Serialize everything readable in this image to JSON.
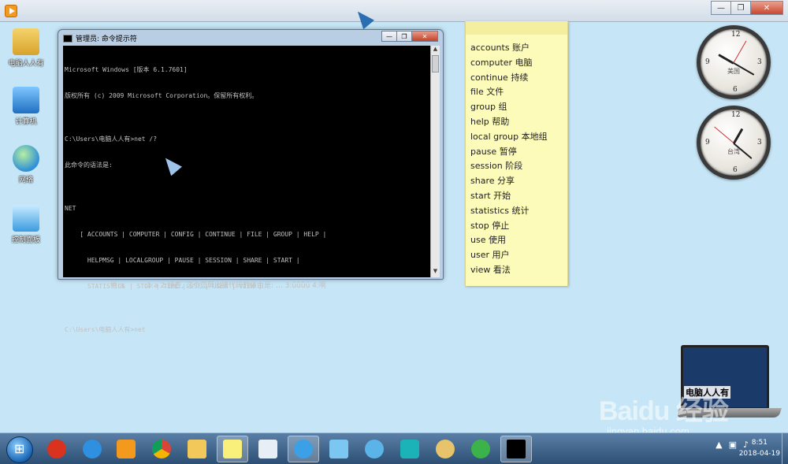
{
  "desktop": {
    "icons": [
      {
        "label": "电脑人人有"
      },
      {
        "label": "计算机"
      },
      {
        "label": "网络"
      },
      {
        "label": "控制面板"
      }
    ]
  },
  "cmd_window": {
    "title": "管理员: 命令提示符",
    "lines": [
      "Microsoft Windows [版本 6.1.7601]",
      "版权所有 (c) 2009 Microsoft Corporation。保留所有权利。",
      "",
      "C:\\Users\\电脑人人有>net /?",
      "此命令的语法是:",
      "",
      "NET",
      "    [ ACCOUNTS | COMPUTER | CONFIG | CONTINUE | FILE | GROUP | HELP |",
      "      HELPMSG | LOCALGROUP | PAUSE | SESSION | SHARE | START |",
      "      STATISTICS | STOP | TIME | USE | USER | VIEW ]",
      "",
      "C:\\Users\\电脑人人有>net"
    ],
    "ime_bar": "半:a         :1:a 2:经查, 这个蓝屏出错代码的缘由是: … 3:ǖǖǖǖ 4:啊"
  },
  "sticky_note": {
    "items": [
      "accounts 账户",
      "computer 电脑",
      "continue 持续",
      "file 文件",
      "group 组",
      "help 帮助",
      "local group 本地组",
      "pause 暂停",
      "session 阶段",
      "share 分享",
      "start 开始",
      "statistics 统计",
      "stop 停止",
      "use 使用",
      "user 用户",
      "view 看法"
    ]
  },
  "clocks": [
    {
      "city": "美国"
    },
    {
      "city": "台湾"
    }
  ],
  "laptop_logo": {
    "text": "电脑人人有"
  },
  "watermark": {
    "brand": "Baidu 经验",
    "url": "jingyan.baidu.com"
  },
  "taskbar": {
    "time": "8:51",
    "date": "2018-04-19"
  }
}
